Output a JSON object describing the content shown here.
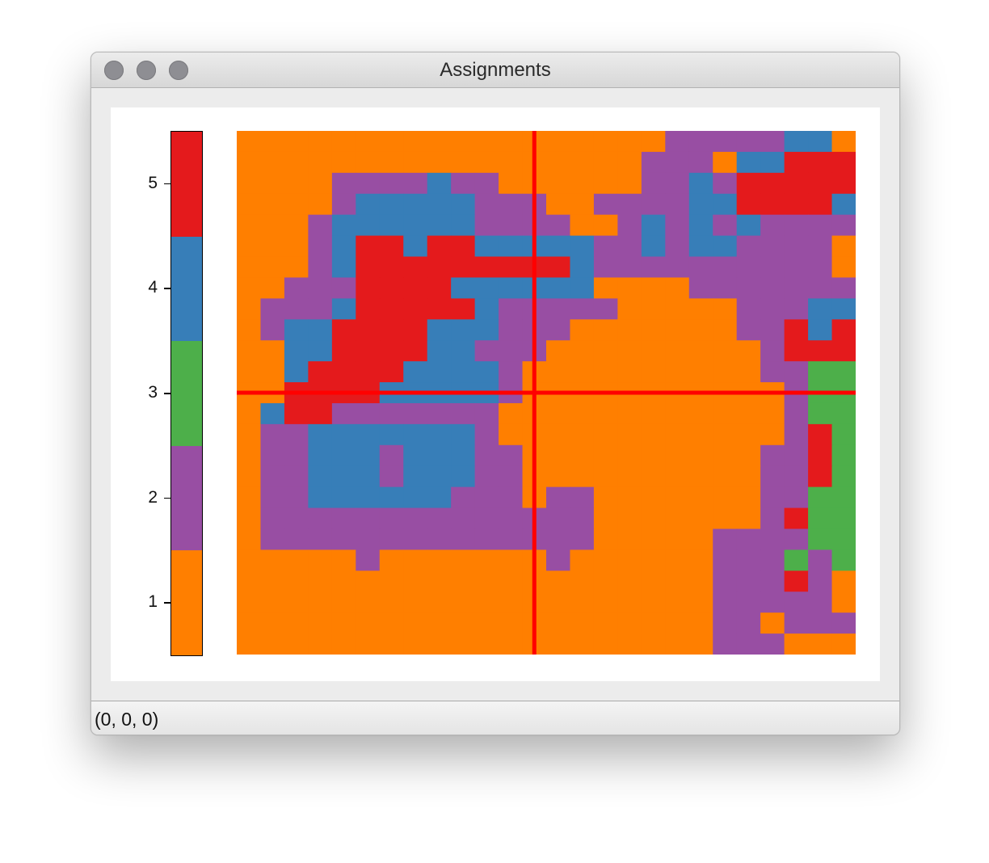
{
  "window": {
    "title": "Assignments",
    "status": "(0, 0, 0)"
  },
  "colors": {
    "1": "#ff7f00",
    "2": "#984ea3",
    "3": "#4daf4a",
    "4": "#377eb8",
    "5": "#e41a1c",
    "crosshair": "#ff0000"
  },
  "chart_data": {
    "type": "heatmap",
    "title": "",
    "xlabel": "",
    "ylabel": "",
    "colorbar": {
      "categories": [
        1,
        2,
        3,
        4,
        5
      ],
      "ticks": [
        "1",
        "2",
        "3",
        "4",
        "5"
      ]
    },
    "crosshair": {
      "col": 12.5,
      "row": 12.5
    },
    "grid": [
      "11111111111111111122222441",
      "11111111111111111222144555",
      "11112222422111111224255555",
      "11112444442221122224455554",
      "11124444442222112424242222",
      "11124554554444422424422221",
      "11124555555555422222222221",
      "11222555544444411112222222",
      "12224555554222221111122244",
      "12445555444222111111122545",
      "11445555442221111111112555",
      "11455554444211111111112233",
      "11555544444211111111111233",
      "14552222222111111111111233",
      "12244444442111111111111253",
      "12244424442211111111112253",
      "12244424442211111111112253",
      "12244444422212211111112233",
      "12222222222222211111112533",
      "12222222222222211111222233",
      "11111211111112111111222323",
      "11111111111111111111222521",
      "11111111111111111111222221",
      "11111111111111111111221222",
      "11111111111111111111222111"
    ]
  }
}
